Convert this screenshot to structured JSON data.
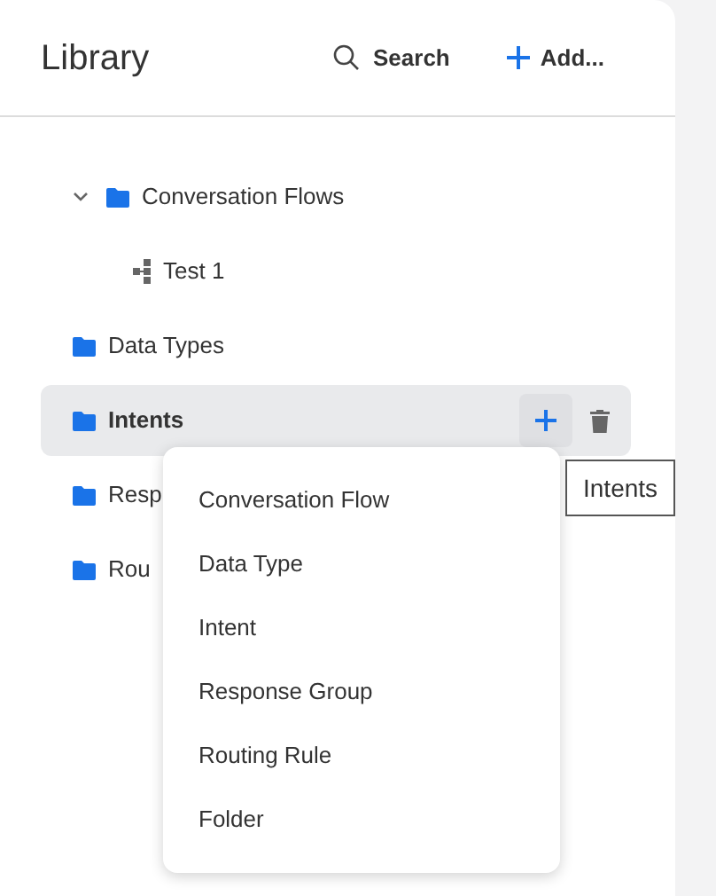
{
  "header": {
    "title": "Library",
    "search_label": "Search",
    "add_label": "Add..."
  },
  "tree": [
    {
      "label": "Conversation Flows",
      "kind": "folder",
      "expanded": true,
      "selected": false,
      "children": [
        {
          "label": "Test 1",
          "kind": "flow",
          "selected": false
        }
      ]
    },
    {
      "label": "Data Types",
      "kind": "folder",
      "selected": false
    },
    {
      "label": "Intents",
      "kind": "folder",
      "selected": true
    },
    {
      "label": "Resp",
      "kind": "folder",
      "selected": false
    },
    {
      "label": "Rou",
      "kind": "folder",
      "selected": false
    }
  ],
  "add_menu": {
    "items": [
      "Conversation Flow",
      "Data Type",
      "Intent",
      "Response Group",
      "Routing Rule",
      "Folder"
    ]
  },
  "tooltip": "Intents"
}
